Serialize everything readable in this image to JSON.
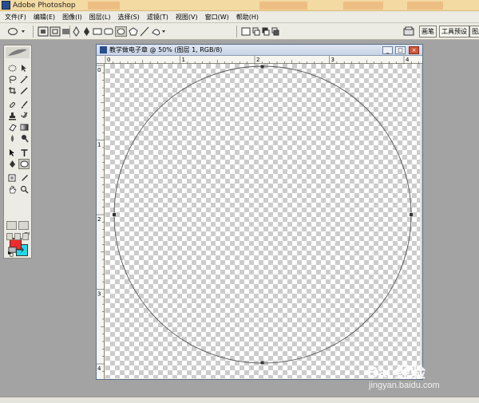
{
  "app": {
    "title": "Adobe Photoshop"
  },
  "menubar": {
    "items": [
      {
        "label": "文件(F)"
      },
      {
        "label": "编辑(E)"
      },
      {
        "label": "图像(I)"
      },
      {
        "label": "图层(L)"
      },
      {
        "label": "选择(S)"
      },
      {
        "label": "滤镜(T)"
      },
      {
        "label": "视图(V)"
      },
      {
        "label": "窗口(W)"
      },
      {
        "label": "帮助(H)"
      }
    ]
  },
  "optionsbar": {
    "active_tool_icon": "ellipse-tool-icon",
    "palette_tabs": [
      {
        "label": "画笔"
      },
      {
        "label": "工具预设"
      },
      {
        "label": "图层"
      }
    ]
  },
  "toolbox": {
    "foreground_color": "#ef2b2b",
    "background_color": "#22d8e8",
    "active_tool": "ellipse-tool"
  },
  "document": {
    "title": "教学做电子章 @ 50% (图层 1, RGB/8)",
    "ruler_top_labels": [
      "0",
      "1",
      "2",
      "3",
      "4"
    ],
    "ruler_left_labels": [
      "0",
      "1",
      "2",
      "3",
      "4"
    ],
    "window_buttons": {
      "minimize": "_",
      "maximize": "□",
      "close": "×"
    }
  },
  "watermark": {
    "logo": "Bai 经验",
    "url": "jingyan.baidu.com"
  }
}
